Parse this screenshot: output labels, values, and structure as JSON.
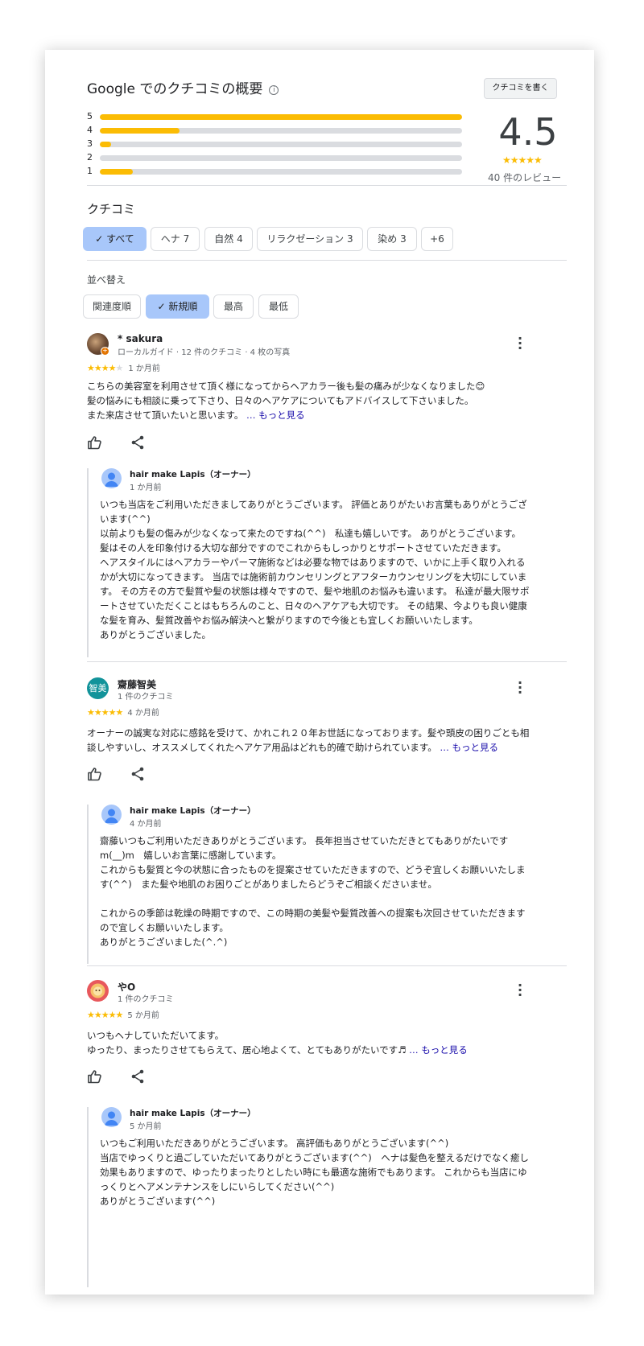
{
  "header": {
    "title": "Google でのクチコミの概要",
    "info_icon": "info-icon",
    "write_review_label": "クチコミを書く"
  },
  "rating_summary": {
    "average": "4.5",
    "stars": "★★★★★",
    "review_count": "40 件のレビュー",
    "bars": [
      {
        "label": "5",
        "fraction": 1.0
      },
      {
        "label": "4",
        "fraction": 0.22
      },
      {
        "label": "3",
        "fraction": 0.03
      },
      {
        "label": "2",
        "fraction": 0.0
      },
      {
        "label": "1",
        "fraction": 0.09
      }
    ]
  },
  "reviews_section": {
    "title": "クチコミ",
    "topic_chips": [
      "すべて",
      "ヘナ 7",
      "自然 4",
      "リラクゼーション 3",
      "染め 3",
      "+6"
    ],
    "sort_label": "並べ替え",
    "sort_options": [
      "関連度順",
      "新規順",
      "最高",
      "最低"
    ]
  },
  "reviews": [
    {
      "name": "* sakura",
      "meta": "ローカルガイド · 12 件のクチコミ · 4 枚の写真",
      "stars_on": "★★★★",
      "stars_off": "★",
      "when": "1 か月前",
      "text": "こちらの美容室を利用させて頂く様になってからヘアカラー後も髪の痛みが少なくなりました😊\n髪の悩みにも相談に乗って下さり、日々のヘアケアについてもアドバイスして下さいました。\nまた来店させて頂いたいと思います。 ",
      "more": "… もっと見る",
      "reply": {
        "name": "hair make Lapis（オーナー）",
        "when": "1 か月前",
        "text": "いつも当店をご利用いただきましてありがとうございます。 評価とありがたいお言葉もありがとうございます(^^)\n以前よりも髪の傷みが少なくなって来たのですね(^^)　私達も嬉しいです。 ありがとうございます。　髪はその人を印象付ける大切な部分ですのでこれからもしっかりとサポートさせていただきます。\nヘアスタイルにはヘアカラーやパーマ施術などは必要な物ではありますので、いかに上手く取り入れるかが大切になってきます。 当店では施術前カウンセリングとアフターカウンセリングを大切にしています。 その方その方で髪質や髪の状態は様々ですので、髪や地肌のお悩みも違います。 私達が最大限サポートさせていただくことはもちろんのこと、日々のヘアケアも大切です。 その結果、今よりも良い健康な髪を育み、髪質改善やお悩み解決へと繋がりますので今後とも宜しくお願いいたします。\nありがとうございました。"
      }
    },
    {
      "name": "齋藤智美",
      "avatar_text": "智美",
      "meta": "1 件のクチコミ",
      "stars_on": "★★★★★",
      "stars_off": "",
      "when": "4 か月前",
      "text": "オーナーの誠実な対応に感銘を受けて、かれこれ２０年お世話になっております。髪や頭皮の困りごとも相談しやすいし、オススメしてくれたヘアケア用品はどれも的確で助けられています。 ",
      "more": "… もっと見る",
      "reply": {
        "name": "hair make Lapis（オーナー）",
        "when": "4 か月前",
        "text": "齋藤いつもご利用いただきありがとうございます。 長年担当させていただきとてもありがたいです m(__)m　嬉しいお言葉に感謝しています。\nこれからも髪質と今の状態に合ったものを提案させていただきますので、どうぞ宜しくお願いいたします(^^)　また髪や地肌のお困りごとがありましたらどうぞご相談くださいませ。\n\nこれからの季節は乾燥の時期ですので、この時期の美髪や髪質改善への提案も次回させていただきますので宜しくお願いいたします。\nありがとうございました(^.^)"
      }
    },
    {
      "name": "やO",
      "meta": "1 件のクチコミ",
      "stars_on": "★★★★★",
      "stars_off": "",
      "when": "5 か月前",
      "text": "いつもヘナしていただいてます。\nゆったり、まったりさせてもらえて、居心地よくて、とてもありがたいです♬ ",
      "more": "… もっと見る",
      "reply": {
        "name": "hair make Lapis（オーナー）",
        "when": "5 か月前",
        "text": "いつもご利用いただきありがとうございます。 高評価もありがとうございます(^^)\n当店でゆっくりと過ごしていただいてありがとうございます(^^)　ヘナは髪色を整えるだけでなく癒し効果もありますので、ゆったりまったりとしたい時にも最適な施術でもあります。 これからも当店にゆっくりとヘアメンテナンスをしにいらしてください(^^)\nありがとうございます(^^)"
      }
    }
  ],
  "colors": {
    "star": "#fbbc04",
    "bar_track": "#dadce0",
    "selected_chip": "#a8c7fa",
    "link": "#1a0dab",
    "avatar_teal": "#12939a"
  }
}
